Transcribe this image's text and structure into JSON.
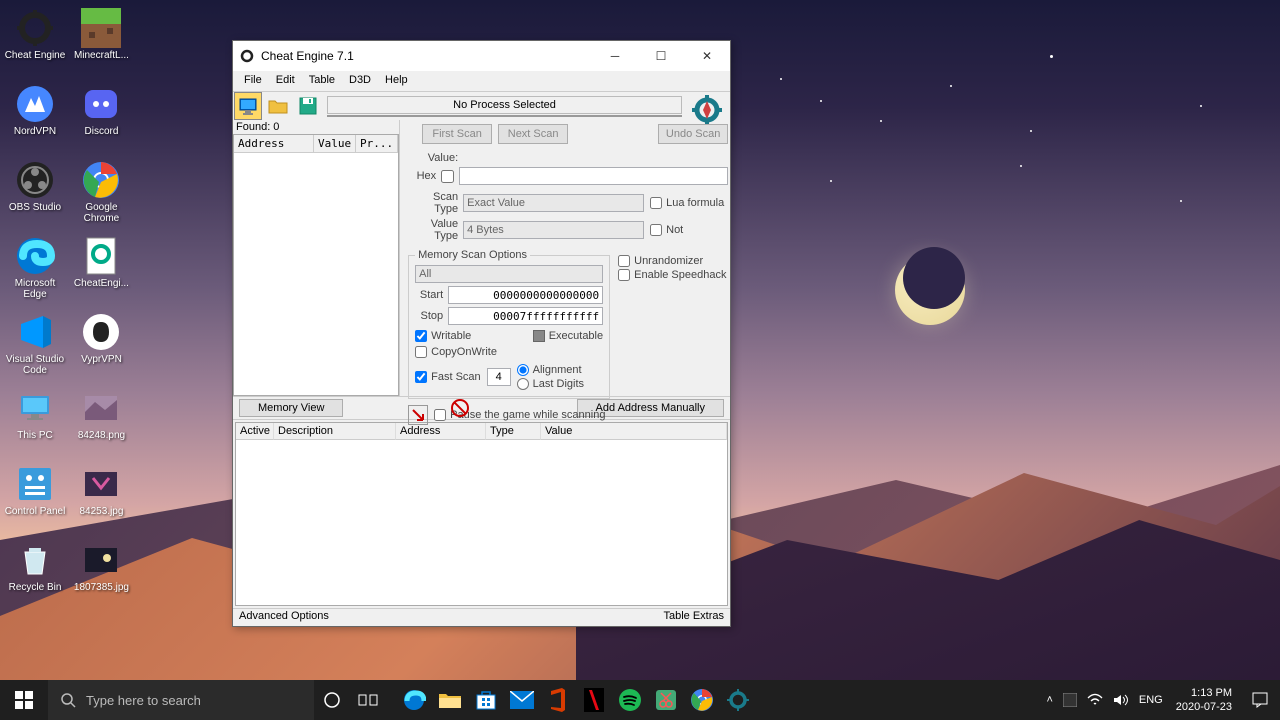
{
  "desktop": {
    "icons": [
      {
        "label": "Cheat Engine"
      },
      {
        "label": "MinecraftL..."
      },
      {
        "label": "NordVPN"
      },
      {
        "label": "Discord"
      },
      {
        "label": "OBS Studio"
      },
      {
        "label": "Google Chrome"
      },
      {
        "label": "Microsoft Edge"
      },
      {
        "label": "CheatEngi..."
      },
      {
        "label": "Visual Studio Code"
      },
      {
        "label": "VyprVPN"
      },
      {
        "label": "This PC"
      },
      {
        "label": "84248.png"
      },
      {
        "label": "Control Panel"
      },
      {
        "label": "84253.jpg"
      },
      {
        "label": "Recycle Bin"
      },
      {
        "label": "1807385.jpg"
      }
    ]
  },
  "window": {
    "title": "Cheat Engine 7.1",
    "menu": [
      "File",
      "Edit",
      "Table",
      "D3D",
      "Help"
    ],
    "no_process": "No Process Selected",
    "settings": "Settings",
    "found": "Found: 0",
    "addr_headers": {
      "addr": "Address",
      "value": "Value",
      "prev": "Pr..."
    },
    "buttons": {
      "first": "First Scan",
      "next": "Next Scan",
      "undo": "Undo Scan",
      "memview": "Memory View",
      "addman": "Add Address Manually"
    },
    "labels": {
      "value": "Value:",
      "hex": "Hex",
      "scan_type": "Scan Type",
      "value_type": "Value Type",
      "lua": "Lua formula",
      "not": "Not",
      "unrand": "Unrandomizer",
      "speedhack": "Enable Speedhack"
    },
    "scan_type_val": "Exact Value",
    "value_type_val": "4 Bytes",
    "mem_opts": {
      "legend": "Memory Scan Options",
      "all": "All",
      "start_lbl": "Start",
      "stop_lbl": "Stop",
      "start": "0000000000000000",
      "stop": "00007fffffffffff",
      "writable": "Writable",
      "exec": "Executable",
      "cow": "CopyOnWrite",
      "fast": "Fast Scan",
      "fast_val": "4",
      "align": "Alignment",
      "last": "Last Digits",
      "pause": "Pause the game while scanning"
    },
    "bt_headers": {
      "active": "Active",
      "desc": "Description",
      "addr": "Address",
      "type": "Type",
      "value": "Value"
    },
    "footer": {
      "adv": "Advanced Options",
      "extras": "Table Extras"
    }
  },
  "taskbar": {
    "search_placeholder": "Type here to search",
    "lang": "ENG",
    "time": "1:13 PM",
    "date": "2020-07-23"
  }
}
